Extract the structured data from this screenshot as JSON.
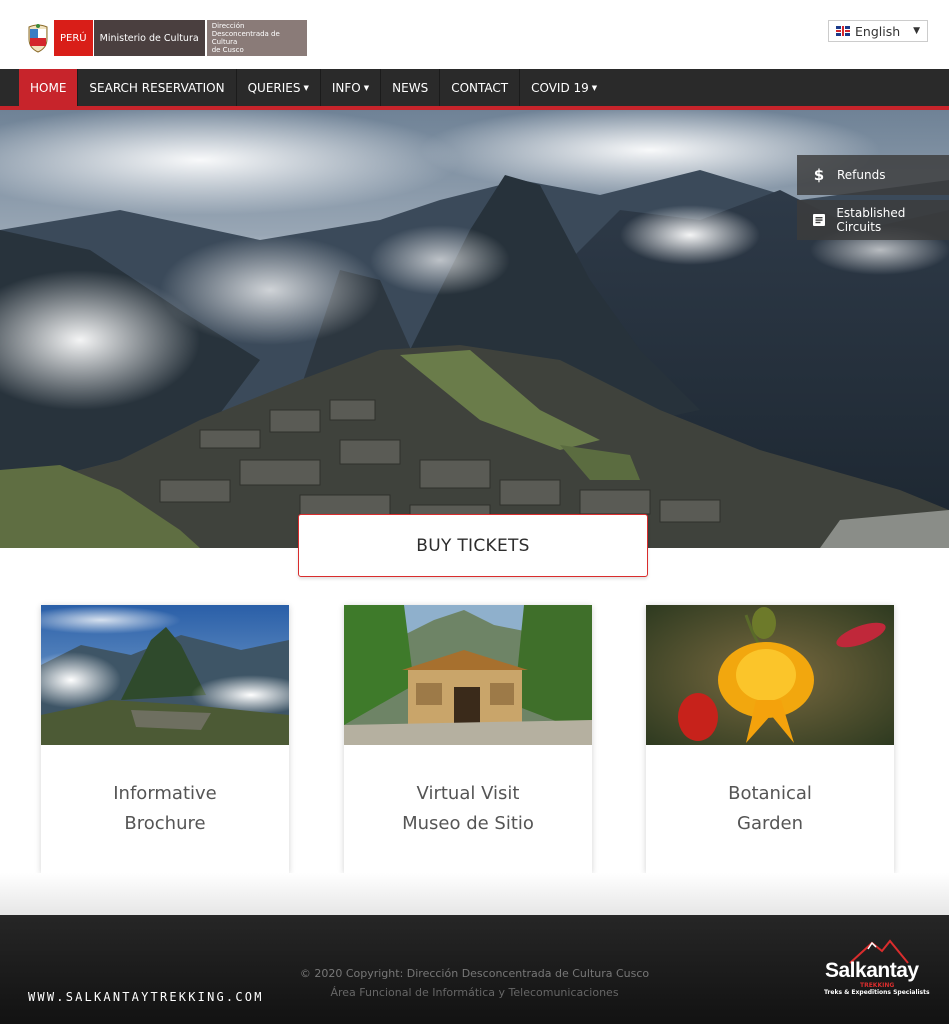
{
  "header": {
    "peru_label": "PERÚ",
    "ministry_label": "Ministerio de Cultura",
    "ddc_label_line1": "Dirección",
    "ddc_label_line2": "Desconcentrada de Cultura",
    "ddc_label_line3": "de Cusco",
    "language": "English"
  },
  "nav": {
    "items": [
      {
        "label": "HOME",
        "active": true
      },
      {
        "label": "SEARCH RESERVATION"
      },
      {
        "label": "QUERIES",
        "dropdown": true
      },
      {
        "label": "INFO",
        "dropdown": true
      },
      {
        "label": "NEWS"
      },
      {
        "label": "CONTACT"
      },
      {
        "label": "COVID 19",
        "dropdown": true
      }
    ],
    "accent_color": "#c7242b"
  },
  "side_buttons": {
    "refunds": "Refunds",
    "circuits": "Established Circuits"
  },
  "hero": {
    "buy_label": "BUY TICKETS"
  },
  "cards": [
    {
      "line1": "Informative",
      "line2": "Brochure"
    },
    {
      "line1": "Virtual Visit",
      "line2": "Museo de Sitio"
    },
    {
      "line1": "Botanical",
      "line2": "Garden"
    }
  ],
  "footer": {
    "copyright": "© 2020 Copyright: Dirección Desconcentrada de Cultura Cusco",
    "area": "Área Funcional de Informática y Telecomunicaciones",
    "website": "WWW.SALKANTAYTREKKING.COM",
    "brand_name": "Salkantay",
    "brand_sub1": "TREKKING",
    "brand_sub2": "Treks & Expeditions Specialists"
  }
}
